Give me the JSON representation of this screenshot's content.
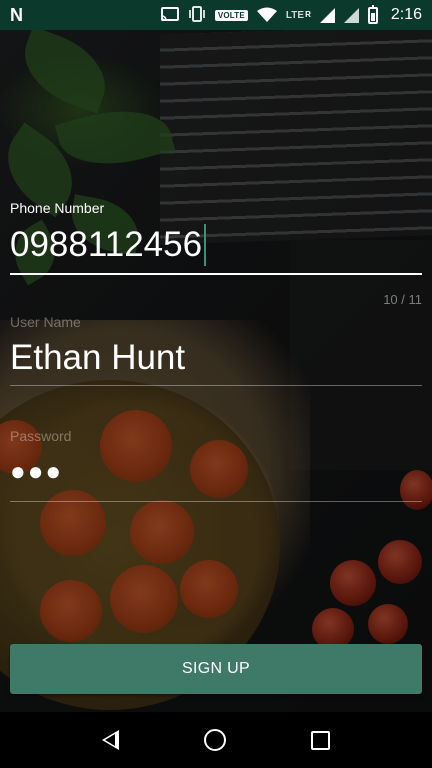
{
  "status_bar": {
    "time": "2:16",
    "network_label": "LTE",
    "roaming_label": "R",
    "volte_label": "VOLTE",
    "icons": [
      "n-logo-icon",
      "cast-icon",
      "vibrate-icon",
      "volte-icon",
      "wifi-icon",
      "signal-icon",
      "signal-icon",
      "battery-icon"
    ],
    "background_color": "#0b3a2c"
  },
  "form": {
    "phone": {
      "label": "Phone Number",
      "value": "0988112456",
      "counter": "10 / 11"
    },
    "username": {
      "label": "User Name",
      "value": "Ethan Hunt"
    },
    "password": {
      "label": "Password",
      "value": "●●●"
    }
  },
  "signup_button": {
    "label": "SIGN UP",
    "color": "#3f7a68"
  },
  "nav_bar": {
    "icons": [
      "back-icon",
      "home-icon",
      "recents-icon"
    ]
  },
  "accent_color": "#3f8f74"
}
